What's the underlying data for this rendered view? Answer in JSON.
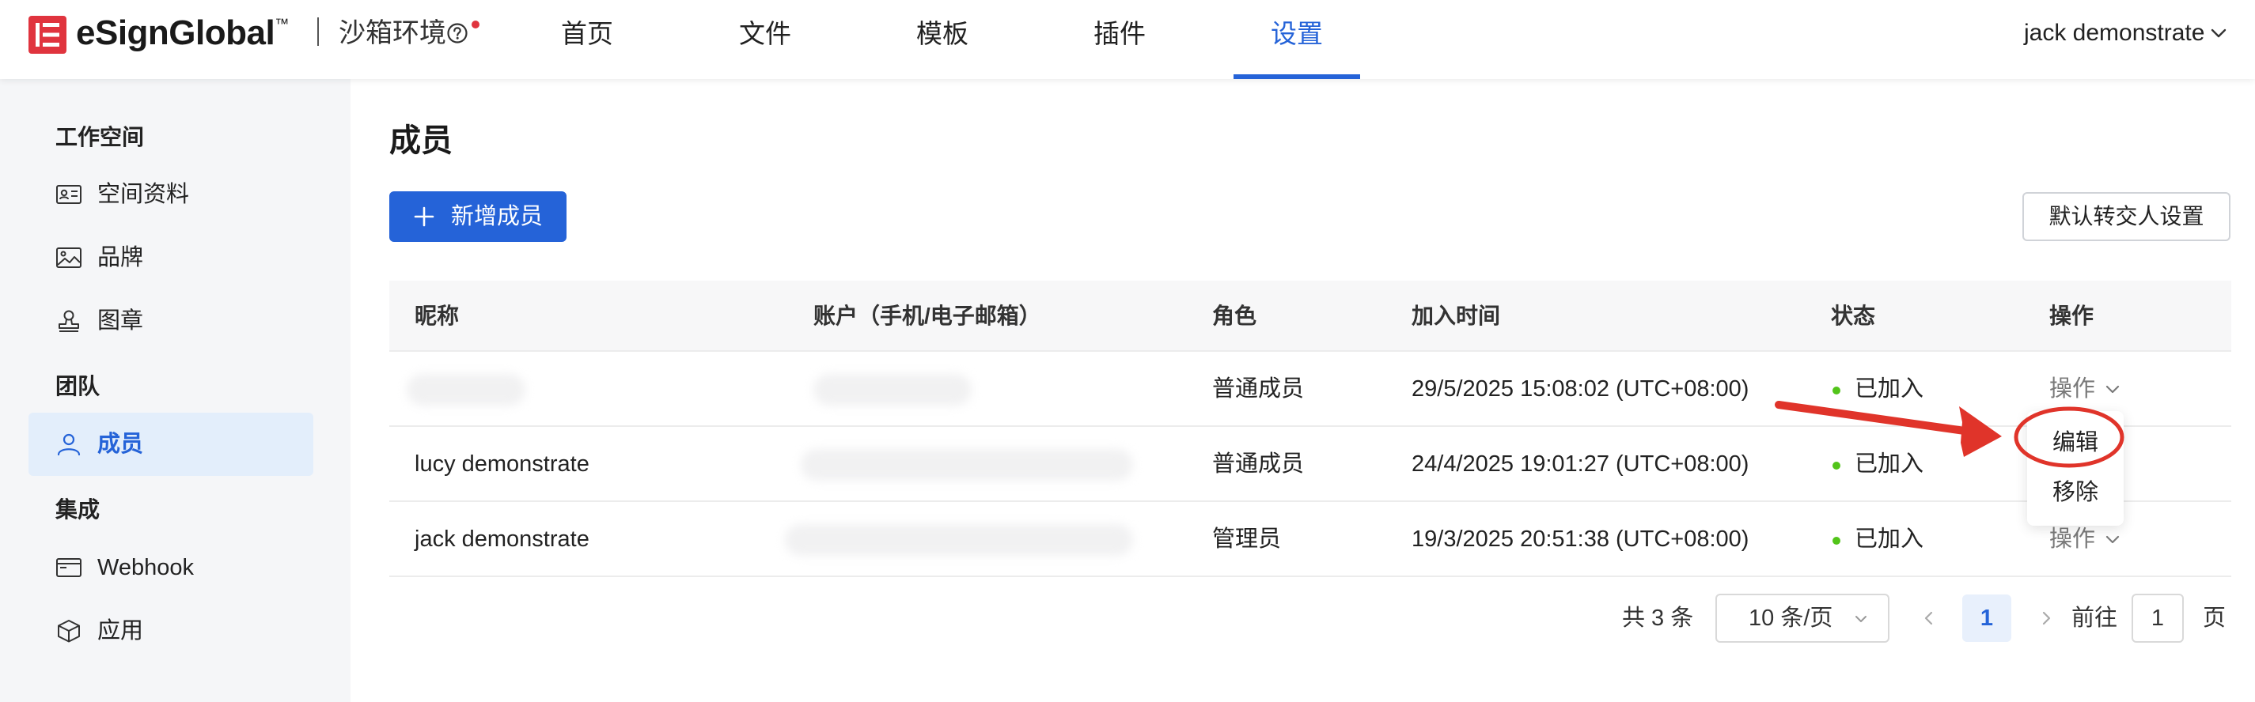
{
  "header": {
    "brand": "eSignGlobal",
    "trademark": "™",
    "environment": "沙箱环境",
    "tabs": [
      "首页",
      "文件",
      "模板",
      "插件",
      "设置"
    ],
    "active_tab": "设置",
    "user_name": "jack demonstrate",
    "brand_color": "#e0343e",
    "accent_color": "#2563d8"
  },
  "sidebar": {
    "sections": {
      "workspace": "工作空间",
      "team": "团队",
      "integration": "集成"
    },
    "items": [
      {
        "label": "空间资料",
        "icon": "id-card-icon"
      },
      {
        "label": "品牌",
        "icon": "image-icon"
      },
      {
        "label": "图章",
        "icon": "stamp-icon"
      },
      {
        "label": "成员",
        "icon": "user-icon",
        "active": true
      },
      {
        "label": "Webhook",
        "icon": "browser-window-icon"
      },
      {
        "label": "应用",
        "icon": "cube-icon"
      }
    ]
  },
  "main": {
    "title": "成员",
    "add_button": "新增成员",
    "default_transfer_button": "默认转交人设置",
    "columns": [
      "昵称",
      "账户（手机/电子邮箱）",
      "角色",
      "加入时间",
      "状态",
      "操作"
    ],
    "rows": [
      {
        "nickname": "",
        "account": "",
        "role": "普通成员",
        "joined": "29/5/2025 15:08:02 (UTC+08:00)",
        "status": "已加入",
        "action": "操作"
      },
      {
        "nickname": "lucy demonstrate",
        "account": "",
        "role": "普通成员",
        "joined": "24/4/2025 19:01:27 (UTC+08:00)",
        "status": "已加入",
        "action": ""
      },
      {
        "nickname": "jack demonstrate",
        "account": "",
        "role": "管理员",
        "joined": "19/3/2025 20:51:38 (UTC+08:00)",
        "status": "已加入",
        "action": "操作"
      }
    ],
    "dropdown": [
      "编辑",
      "移除"
    ],
    "status_color": "#52c41a",
    "annotation_color": "#e0342a"
  },
  "pagination": {
    "total": "共 3 条",
    "page_size": "10 条/页",
    "current_page": "1",
    "goto_label": "前往",
    "goto_value": "1",
    "page_suffix": "页"
  }
}
